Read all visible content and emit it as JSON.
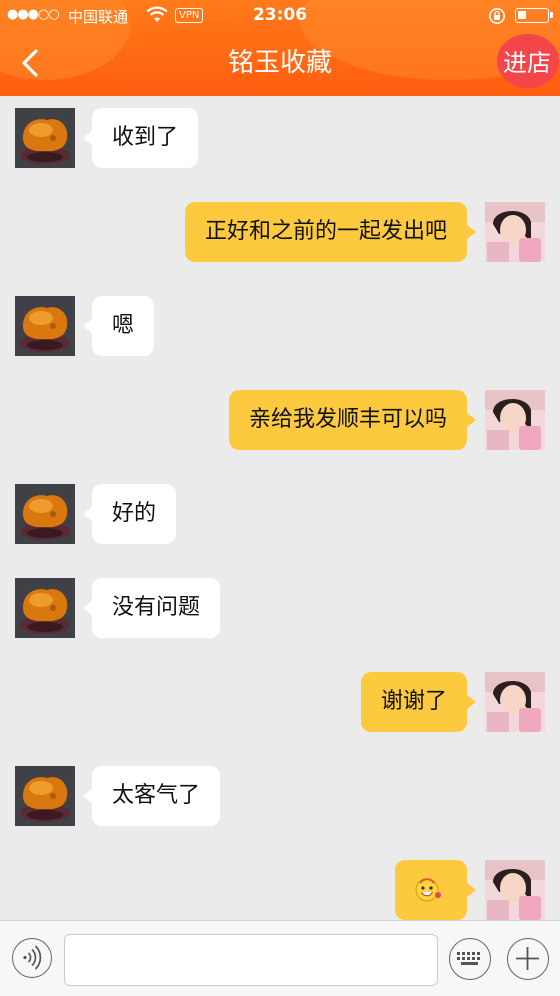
{
  "status_bar": {
    "signal": "●●●○○",
    "carrier": "中国联通",
    "vpn": "VPN",
    "time": "23:06"
  },
  "header": {
    "title": "铭玉收藏",
    "shop_button": "进店",
    "back_icon": "chevron-left-icon"
  },
  "messages": [
    {
      "from": "shop",
      "text": "收到了"
    },
    {
      "from": "me",
      "text": "正好和之前的一起发出吧"
    },
    {
      "from": "shop",
      "text": "嗯"
    },
    {
      "from": "me",
      "text": "亲给我发顺丰可以吗"
    },
    {
      "from": "shop",
      "text": "好的"
    },
    {
      "from": "shop",
      "text": "没有问题"
    },
    {
      "from": "me",
      "text": "谢谢了"
    },
    {
      "from": "shop",
      "text": "太客气了"
    },
    {
      "from": "me",
      "emoji": "smiley-face-emoji"
    }
  ],
  "input_bar": {
    "voice_icon": "voice-icon",
    "keyboard_icon": "keyboard-icon",
    "plus_icon": "plus-icon",
    "text_value": ""
  },
  "colors": {
    "header": "#ff6a13",
    "outgoing_bubble": "#fcc93f",
    "incoming_bubble": "#ffffff",
    "background": "#ebebeb"
  }
}
